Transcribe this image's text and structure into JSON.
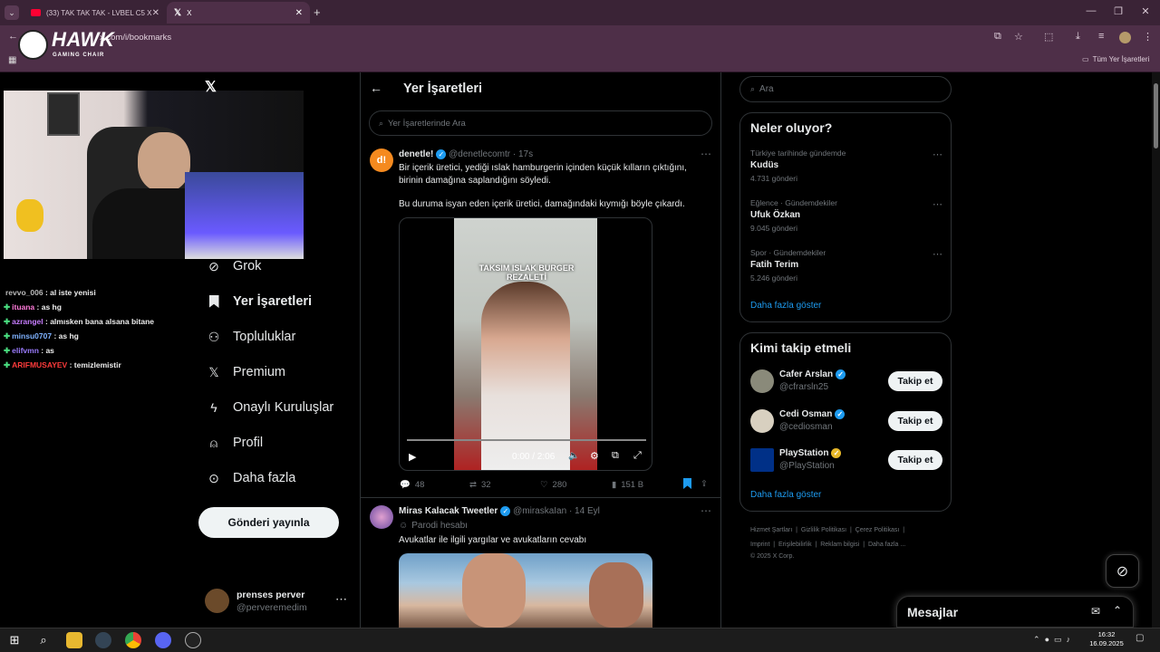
{
  "browser": {
    "tabs": [
      {
        "title": "(33) TAK TAK TAK - LVBEL C5 X"
      },
      {
        "title": "X"
      }
    ],
    "url": "x.com/i/bookmarks",
    "bookmarks_folder": "Tüm Yer İşaretleri"
  },
  "overlay": {
    "brand": "HAWK",
    "brand_sub": "GAMING CHAIR"
  },
  "chat": [
    {
      "user": "revvo_006",
      "msg": ": al iste yenisi",
      "color": "#bbbbbb"
    },
    {
      "user": "ituana",
      "msg": ": as hg",
      "color": "#ff7ad9"
    },
    {
      "user": "azrangel",
      "msg": ": almısken bana alsana bitane",
      "color": "#c77dff"
    },
    {
      "user": "minsu0707",
      "msg": ": as hg",
      "color": "#7fb2ff"
    },
    {
      "user": "elifvmn",
      "msg": ": as",
      "color": "#9b7cff"
    },
    {
      "user": "ARIFMUSAYEV",
      "msg": ": temizlemistir",
      "color": "#ff3b3b"
    }
  ],
  "nav": {
    "items": [
      {
        "label": "Grok",
        "icon": "grok-icon"
      },
      {
        "label": "Yer İşaretleri",
        "icon": "bookmark-icon"
      },
      {
        "label": "Topluluklar",
        "icon": "communities-icon"
      },
      {
        "label": "Premium",
        "icon": "x-logo-icon"
      },
      {
        "label": "Onaylı Kuruluşlar",
        "icon": "lightning-icon"
      },
      {
        "label": "Profil",
        "icon": "person-icon"
      },
      {
        "label": "Daha fazla",
        "icon": "more-circle-icon"
      }
    ],
    "post_button": "Gönderi yayınla",
    "account": {
      "name": "prenses perver",
      "handle": "@perveremedim"
    }
  },
  "main": {
    "title": "Yer İşaretleri",
    "search_placeholder": "Yer İşaretlerinde Ara",
    "tweets": [
      {
        "name": "denetle!",
        "handle": "@denetlecomtr",
        "time": "· 17s",
        "text1": "Bir içerik üretici, yediği ıslak hamburgerin içinden küçük kılların çıktığını, birinin damağına saplandığını söyledi.",
        "text2": "Bu duruma isyan eden içerik üretici, damağındaki kıymığı böyle çıkardı.",
        "video_caption": "TAKSIM ISLAK BURGER REZALETİ",
        "video_time": "0:00 / 2:06",
        "replies": "48",
        "retweets": "32",
        "likes": "280",
        "views": "151 B"
      },
      {
        "name": "Miras Kalacak Tweetler",
        "handle": "@miraskaIan",
        "time": "· 14 Eyl",
        "badge": "Parodi hesabı",
        "text1": "Avukatlar ile ilgili yargılar ve avukatların cevabı"
      }
    ]
  },
  "right": {
    "search_placeholder": "Ara",
    "trends_title": "Neler oluyor?",
    "trends": [
      {
        "context": "Türkiye tarihinde gündemde",
        "name": "Kudüs",
        "count": "4.731 gönderi"
      },
      {
        "context": "Eğlence · Gündemdekiler",
        "name": "Ufuk Özkan",
        "count": "9.045 gönderi"
      },
      {
        "context": "Spor · Gündemdekiler",
        "name": "Fatih Terim",
        "count": "5.246 gönderi"
      }
    ],
    "show_more": "Daha fazla göster",
    "follow_title": "Kimi takip etmeli",
    "follow": [
      {
        "name": "Cafer Arslan",
        "handle": "@cfrarsln25",
        "badge": "blue"
      },
      {
        "name": "Cedi Osman",
        "handle": "@cediosman",
        "badge": "blue"
      },
      {
        "name": "PlayStation",
        "handle": "@PlayStation",
        "badge": "gold"
      }
    ],
    "follow_button": "Takip et",
    "footer_line1": [
      "Hizmet Şartları",
      "Gizlilik Politikası",
      "Çerez Politikası"
    ],
    "footer_line2": [
      "Imprint",
      "Erişilebilirlik",
      "Reklam bilgisi",
      "Daha fazla ..."
    ],
    "copyright": "© 2025 X Corp."
  },
  "messages": {
    "title": "Mesajlar"
  },
  "taskbar": {
    "time": "16:32",
    "date": "16.09.2025"
  }
}
